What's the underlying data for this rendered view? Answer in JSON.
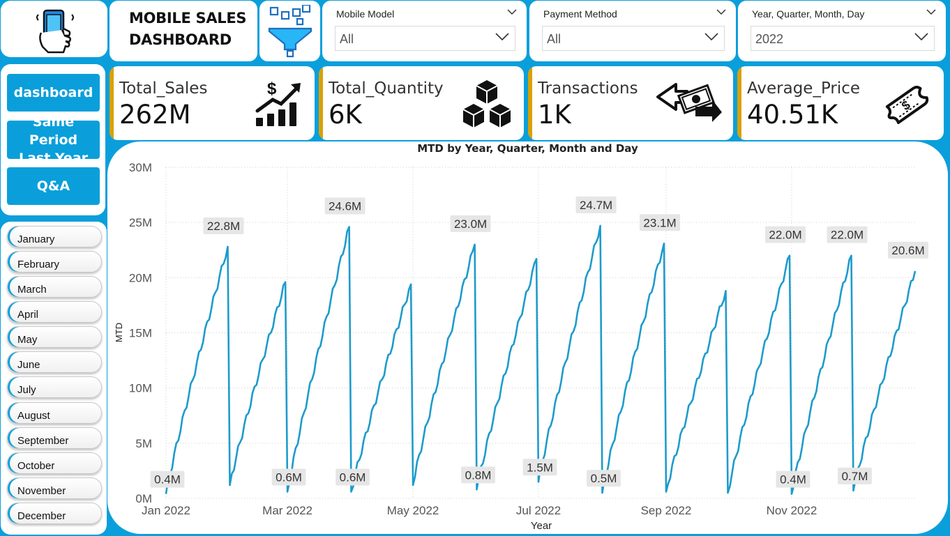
{
  "header": {
    "logo_icon": "phone-in-hand-icon",
    "title_line1": "MOBILE SALES",
    "title_line2": "DASHBOARD",
    "filter_icon": "funnel-filter-icon"
  },
  "slicers": [
    {
      "title": "Mobile Model",
      "value": "All"
    },
    {
      "title": "Payment Method",
      "value": "All"
    },
    {
      "title": "Year, Quarter, Month, Day",
      "value": "2022"
    }
  ],
  "nav": {
    "dashboard": "dashboard",
    "same_period_line1": "Same Period",
    "same_period_line2": "Last Year",
    "qa": "Q&A"
  },
  "months": [
    "January",
    "February",
    "March",
    "April",
    "May",
    "June",
    "July",
    "August",
    "September",
    "October",
    "November",
    "December"
  ],
  "kpis": [
    {
      "label": "Total_Sales",
      "value": "262M",
      "icon": "sales-growth-chart-icon"
    },
    {
      "label": "Total_Quantity",
      "value": "6K",
      "icon": "boxes-icon"
    },
    {
      "label": "Transactions",
      "value": "1K",
      "icon": "money-exchange-icon"
    },
    {
      "label": "Average_Price",
      "value": "40.51K",
      "icon": "price-tag-icon"
    }
  ],
  "colors": {
    "background": "#0a9fdb",
    "line": "#1d9bcb",
    "accent": "#d9a100"
  },
  "chart_data": {
    "type": "line",
    "title": "MTD by Year, Quarter, Month and Day",
    "xlabel": "Year",
    "ylabel": "MTD",
    "ylim": [
      0,
      30
    ],
    "y_unit": "M",
    "yticks": [
      "0M",
      "5M",
      "10M",
      "15M",
      "20M",
      "25M",
      "30M"
    ],
    "xticks": [
      "Jan 2022",
      "Mar 2022",
      "May 2022",
      "Jul 2022",
      "Sep 2022",
      "Nov 2022"
    ],
    "grid": true,
    "series": [
      {
        "months": [
          {
            "month": "Jan 2022",
            "start": 0.4,
            "end": 22.8,
            "days": 31,
            "start_label": "0.4M",
            "end_label": "22.8M"
          },
          {
            "month": "Feb 2022",
            "start": 1.2,
            "end": 19.6,
            "days": 28
          },
          {
            "month": "Mar 2022",
            "start": 0.6,
            "end": 24.6,
            "days": 31,
            "start_label": "0.6M",
            "end_label": "24.6M"
          },
          {
            "month": "Apr 2022",
            "start": 0.6,
            "end": 19.4,
            "days": 30,
            "start_label": "0.6M"
          },
          {
            "month": "May 2022",
            "start": 1.2,
            "end": 23.0,
            "days": 31,
            "end_label": "23.0M"
          },
          {
            "month": "Jun 2022",
            "start": 0.8,
            "end": 21.7,
            "days": 30,
            "start_label": "0.8M"
          },
          {
            "month": "Jul 2022",
            "start": 1.5,
            "end": 24.7,
            "days": 31,
            "start_label": "1.5M",
            "end_label": "24.7M"
          },
          {
            "month": "Aug 2022",
            "start": 0.5,
            "end": 23.1,
            "days": 31,
            "start_label": "0.5M",
            "end_label": "23.1M"
          },
          {
            "month": "Sep 2022",
            "start": 0.6,
            "end": 18.8,
            "days": 30
          },
          {
            "month": "Oct 2022",
            "start": 0.5,
            "end": 22.0,
            "days": 31,
            "end_label": "22.0M"
          },
          {
            "month": "Nov 2022",
            "start": 0.4,
            "end": 22.0,
            "days": 30,
            "start_label": "0.4M",
            "end_label": "22.0M"
          },
          {
            "month": "Dec 2022",
            "start": 0.7,
            "end": 20.6,
            "days": 31,
            "start_label": "0.7M",
            "end_label": "20.6M"
          }
        ]
      }
    ]
  }
}
